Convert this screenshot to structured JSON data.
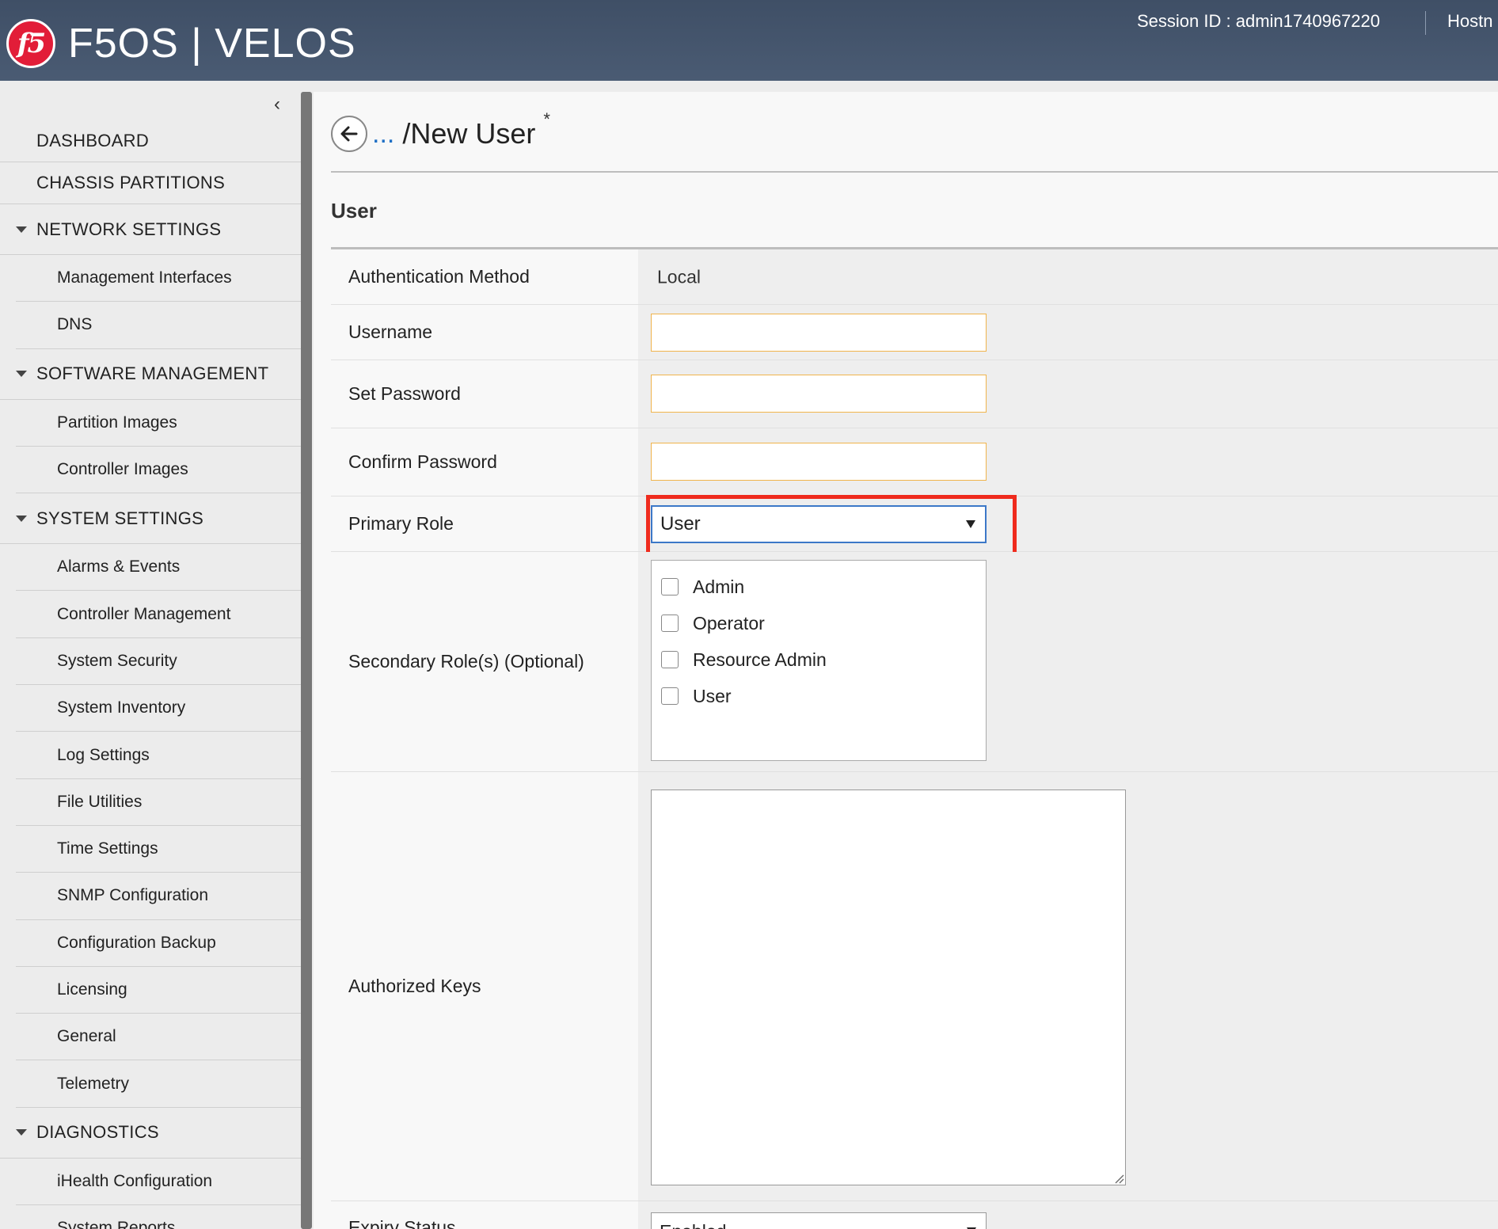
{
  "header": {
    "product_name": "F5OS | VELOS",
    "logo_text": "f5",
    "session": "Session ID : admin1740967220",
    "hostname_label": "Hostn"
  },
  "sidebar": {
    "top_items": [
      "DASHBOARD",
      "CHASSIS PARTITIONS"
    ],
    "network": {
      "title": "NETWORK SETTINGS",
      "items": [
        "Management Interfaces",
        "DNS"
      ]
    },
    "software": {
      "title": "SOFTWARE MANAGEMENT",
      "items": [
        "Partition Images",
        "Controller Images"
      ]
    },
    "system": {
      "title": "SYSTEM SETTINGS",
      "items": [
        "Alarms & Events",
        "Controller Management",
        "System Security",
        "System Inventory",
        "Log Settings",
        "File Utilities",
        "Time Settings",
        "SNMP Configuration",
        "Configuration Backup",
        "Licensing",
        "General",
        "Telemetry"
      ]
    },
    "diagnostics": {
      "title": "DIAGNOSTICS",
      "items": [
        "iHealth Configuration",
        "System Reports"
      ]
    }
  },
  "page": {
    "breadcrumb_ellipsis": "...",
    "title": "/New User",
    "unsaved_marker": "*",
    "section_title": "User"
  },
  "form": {
    "auth_method": {
      "label": "Authentication Method",
      "value": "Local"
    },
    "username": {
      "label": "Username",
      "value": ""
    },
    "set_password": {
      "label": "Set Password",
      "value": ""
    },
    "confirm_password": {
      "label": "Confirm Password",
      "value": ""
    },
    "primary_role": {
      "label": "Primary Role",
      "value": "User"
    },
    "secondary_roles": {
      "label": "Secondary Role(s) (Optional)",
      "options": [
        "Admin",
        "Operator",
        "Resource Admin",
        "User"
      ]
    },
    "authorized_keys": {
      "label": "Authorized Keys",
      "value": ""
    },
    "expiry_status": {
      "label": "Expiry Status",
      "value": "Enabled"
    }
  },
  "colors": {
    "header_bg": "#44546b",
    "highlight_border": "#ef2b1d",
    "input_border": "#f0b44c",
    "focus_border": "#3c78c8",
    "link": "#1f6fc5"
  }
}
